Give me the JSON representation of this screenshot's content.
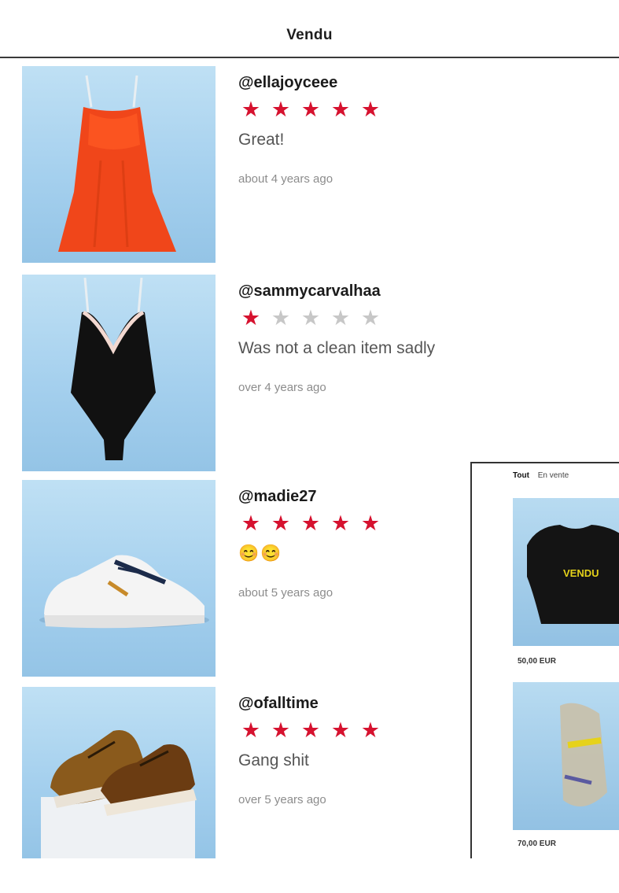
{
  "header": {
    "title": "Vendu"
  },
  "reviews": [
    {
      "handle": "@ellajoyceee",
      "rating": 5,
      "comment": "Great!",
      "time": "about 4 years ago"
    },
    {
      "handle": "@sammycarvalhaa",
      "rating": 1,
      "comment": "Was not a clean item sadly",
      "time": "over 4 years ago"
    },
    {
      "handle": "@madie27",
      "rating": 5,
      "comment": "😊😊",
      "time": "about 5 years ago"
    },
    {
      "handle": "@ofalltime",
      "rating": 5,
      "comment": "Gang shit",
      "time": "over 5 years ago"
    }
  ],
  "popup": {
    "tabs": [
      "Tout",
      "En vente"
    ],
    "items": [
      {
        "price": "50,00 EUR",
        "brand_text": "VENDU"
      },
      {
        "price": "70,00 EUR",
        "brand_text": ""
      }
    ]
  },
  "colors": {
    "star_on": "#d6122f",
    "star_off": "#c7c7c7",
    "photo_bg": "#a5d0ee"
  },
  "icons": [
    "star-icon"
  ]
}
